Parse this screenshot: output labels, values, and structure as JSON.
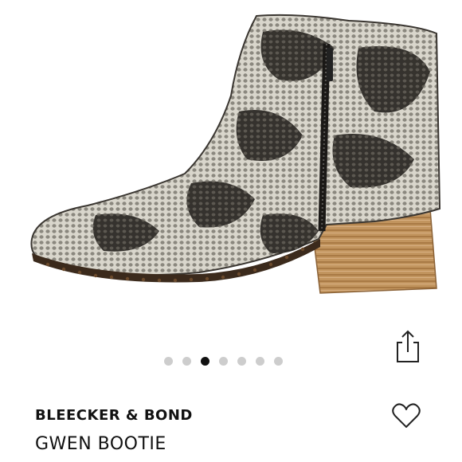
{
  "product": {
    "brand": "BLEECKER & BOND",
    "name": "GWEN BOOTIE"
  },
  "carousel": {
    "total": 7,
    "active_index": 2,
    "active_color": "#111111",
    "inactive_color": "#cdcdcd"
  },
  "icons": {
    "share": "share-icon",
    "like": "heart-outline-icon"
  }
}
